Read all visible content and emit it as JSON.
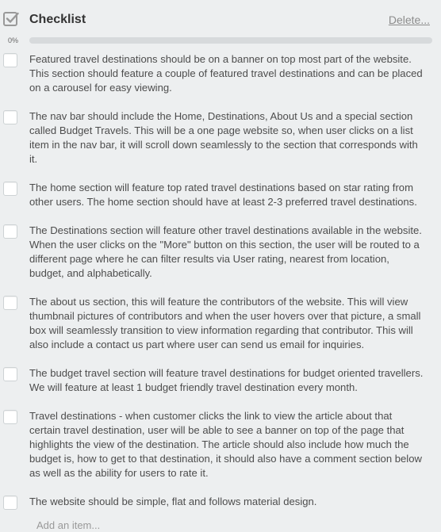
{
  "header": {
    "title": "Checklist",
    "delete_label": "Delete...",
    "icon": "checklist-icon"
  },
  "progress": {
    "percent_label": "0%",
    "value": 0
  },
  "items": [
    {
      "text": "Featured travel destinations should be on a banner on top most part of the website. This section should feature a couple of featured travel destinations and can be placed on a carousel for easy viewing.",
      "checked": false
    },
    {
      "text": "The nav bar should include the Home, Destinations, About Us and a special section called Budget Travels. This will be a one page website so, when user clicks on a list item in the nav bar, it will scroll down seamlessly to the section that corresponds with it.",
      "checked": false
    },
    {
      "text": "The home section will feature top rated travel destinations based on star rating from other users. The home section should have at least 2-3 preferred travel destinations.",
      "checked": false
    },
    {
      "text": "The Destinations section will feature other travel destinations available in the website. When the user clicks on the \"More\" button on this section, the user will be routed to a different page where he can filter results via User rating, nearest from location, budget, and alphabetically.",
      "checked": false
    },
    {
      "text": "The about us section, this will feature the contributors of the website. This will view thumbnail pictures of contributors and when the user hovers over that picture, a small box will seamlessly transition to view information regarding that contributor. This will also include a contact us part where user can send us email for inquiries.",
      "checked": false
    },
    {
      "text": "The budget travel section will feature travel destinations for budget oriented travellers. We will feature at least 1 budget friendly travel destination every month.",
      "checked": false
    },
    {
      "text": "Travel destinations - when customer clicks the link to view the article about that certain travel destination, user will be able to see a banner on top of the page that highlights the view of the destination. The article should also include how much the budget is, how to get to that destination, it should also have a comment section below as well as the ability for users to rate it.",
      "checked": false
    },
    {
      "text": "The website should be simple, flat and follows material design.",
      "checked": false
    }
  ],
  "add_item_label": "Add an item...",
  "colors": {
    "background": "#edeff0",
    "progress_track": "#d7dadc",
    "progress_fill": "#5aac44",
    "text": "#4d4d4d"
  }
}
